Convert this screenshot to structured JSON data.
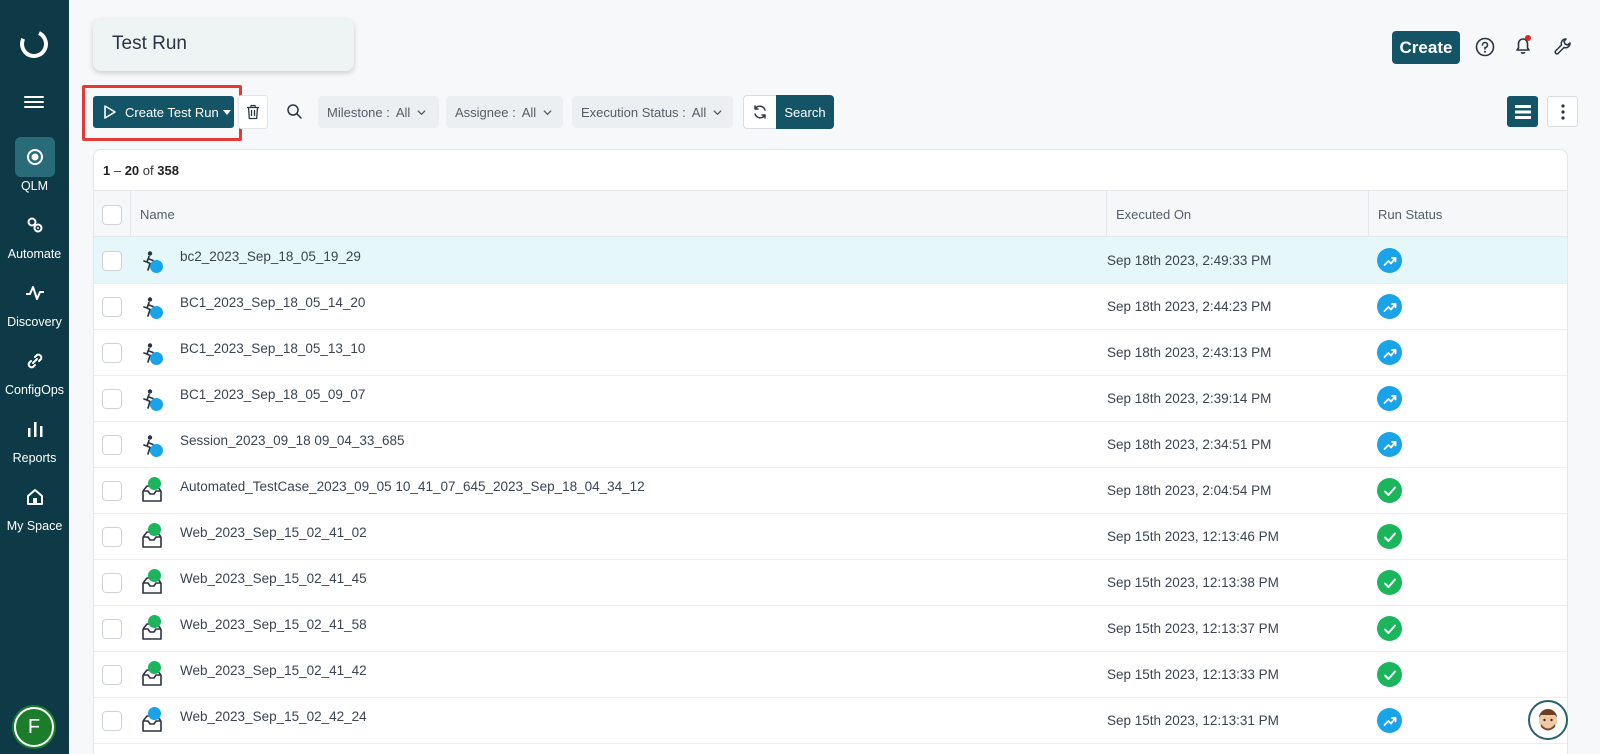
{
  "sidebar": {
    "items": [
      {
        "label": "QLM",
        "icon": "target-icon",
        "active": true
      },
      {
        "label": "Automate",
        "icon": "gears-icon",
        "active": false
      },
      {
        "label": "Discovery",
        "icon": "pulse-icon",
        "active": false
      },
      {
        "label": "ConfigOps",
        "icon": "link-icon",
        "active": false
      },
      {
        "label": "Reports",
        "icon": "bar-chart-icon",
        "active": false
      },
      {
        "label": "My Space",
        "icon": "home-icon",
        "active": false
      }
    ],
    "user_initial": "F"
  },
  "header": {
    "title": "Test Run",
    "create_label": "Create"
  },
  "toolbar": {
    "create_test_run_label": "Create Test Run",
    "filters": [
      {
        "label": "Milestone :",
        "value": "All"
      },
      {
        "label": "Assignee :",
        "value": "All"
      },
      {
        "label": "Execution Status :",
        "value": "All"
      }
    ],
    "search_label": "Search"
  },
  "pager": {
    "start": "1",
    "sep": " – ",
    "end": "20",
    "of": " of ",
    "total": "358"
  },
  "table": {
    "columns": {
      "name": "Name",
      "executed_on": "Executed On",
      "run_status": "Run Status"
    },
    "rows": [
      {
        "name": "bc2_2023_Sep_18_05_19_29",
        "executed_on": "Sep 18th 2023, 2:49:33 PM",
        "type": "manual",
        "status": "in-progress"
      },
      {
        "name": "BC1_2023_Sep_18_05_14_20",
        "executed_on": "Sep 18th 2023, 2:44:23 PM",
        "type": "manual",
        "status": "in-progress"
      },
      {
        "name": "BC1_2023_Sep_18_05_13_10",
        "executed_on": "Sep 18th 2023, 2:43:13 PM",
        "type": "manual",
        "status": "in-progress"
      },
      {
        "name": "BC1_2023_Sep_18_05_09_07",
        "executed_on": "Sep 18th 2023, 2:39:14 PM",
        "type": "manual",
        "status": "in-progress"
      },
      {
        "name": "Session_2023_09_18 09_04_33_685",
        "executed_on": "Sep 18th 2023, 2:34:51 PM",
        "type": "manual",
        "status": "in-progress"
      },
      {
        "name": "Automated_TestCase_2023_09_05 10_41_07_645_2023_Sep_18_04_34_12",
        "executed_on": "Sep 18th 2023, 2:04:54 PM",
        "type": "automated-pass",
        "status": "passed"
      },
      {
        "name": "Web_2023_Sep_15_02_41_02",
        "executed_on": "Sep 15th 2023, 12:13:46 PM",
        "type": "automated-pass",
        "status": "passed"
      },
      {
        "name": "Web_2023_Sep_15_02_41_45",
        "executed_on": "Sep 15th 2023, 12:13:38 PM",
        "type": "automated-pass",
        "status": "passed"
      },
      {
        "name": "Web_2023_Sep_15_02_41_58",
        "executed_on": "Sep 15th 2023, 12:13:37 PM",
        "type": "automated-pass",
        "status": "passed"
      },
      {
        "name": "Web_2023_Sep_15_02_41_42",
        "executed_on": "Sep 15th 2023, 12:13:33 PM",
        "type": "automated-pass",
        "status": "passed"
      },
      {
        "name": "Web_2023_Sep_15_02_42_24",
        "executed_on": "Sep 15th 2023, 12:13:31 PM",
        "type": "automated-progress",
        "status": "in-progress"
      }
    ]
  },
  "colors": {
    "sidebar_bg": "#0e3a47",
    "primary": "#135566",
    "highlight_border": "#e53935",
    "status_in_progress": "#1aa3e8",
    "status_passed": "#1bb55c",
    "row_highlight": "#e6f7fa"
  }
}
